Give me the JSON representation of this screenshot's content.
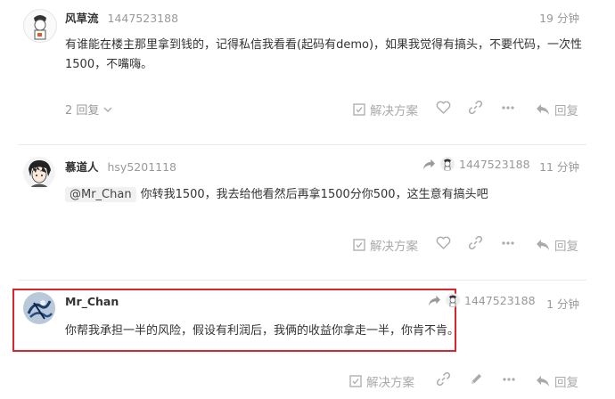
{
  "comments": [
    {
      "name": "风草流",
      "uid": "1447523188",
      "time": "19 分钟",
      "text_line1": "有谁能在楼主那里拿到钱的，记得私信我看看(起码有demo)，如果我觉得有搞头，不要代码，一次性",
      "text_line2": "1500，不嘴嗨。",
      "replies_label": "2 回复",
      "solution_label": "解决方案",
      "reply_label": "回复"
    },
    {
      "name": "慕道人",
      "uid": "hsy5201118",
      "reply_to": "1447523188",
      "time": "11 分钟",
      "mention": "@Mr_Chan",
      "text": "你转我1500，我去给他看然后再拿1500分你500，这生意有搞头吧",
      "solution_label": "解决方案",
      "reply_label": "回复"
    },
    {
      "name": "Mr_Chan",
      "uid": "",
      "reply_to": "1447523188",
      "time": "1 分钟",
      "text": "你帮我承担一半的风险，假设有利润后，我俩的收益你拿走一半，你肯不肯。",
      "solution_label": "解决方案",
      "reply_label": "回复"
    }
  ],
  "colors": {
    "highlight_border": "#d9262c",
    "icon_gray": "#aaaaaa"
  }
}
